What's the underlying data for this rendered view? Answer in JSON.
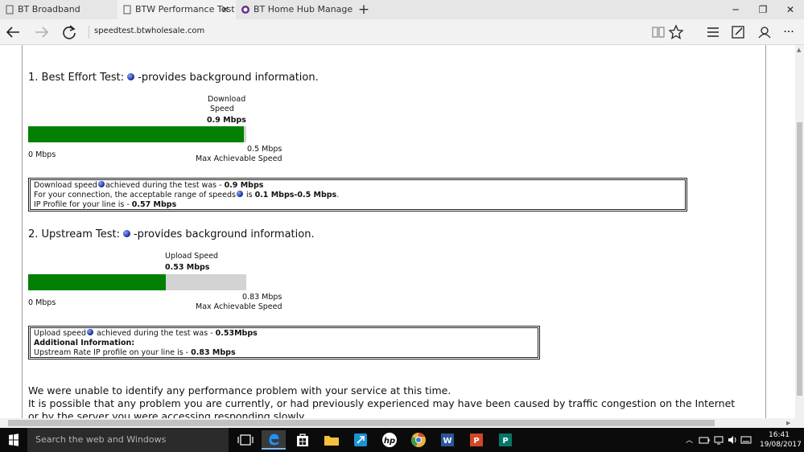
{
  "browser": {
    "tabs": [
      {
        "title": "BT Broadband",
        "active": false
      },
      {
        "title": "BTW Performance Test",
        "active": true
      },
      {
        "title": "BT Home Hub Manager - Ev",
        "active": false
      }
    ],
    "url_host": "speedtest.btwholesale.com"
  },
  "page": {
    "best_effort": {
      "title": "1. Best Effort Test:",
      "title_suffix": "-provides background information.",
      "speed_label_line1": "Download",
      "speed_label_line2": "Speed",
      "speed_value": "0.9 Mbps",
      "min_label": "0 Mbps",
      "max_value": "0.5 Mbps",
      "max_label": "Max Achievable Speed",
      "fill_fraction": 0.99,
      "info": {
        "line1_prefix": "Download speed",
        "line1_mid": "achieved during the test was - ",
        "line1_value": "0.9 Mbps",
        "line2_prefix": "For your connection, the acceptable range of speeds",
        "line2_mid": " is ",
        "line2_value": "0.1 Mbps-0.5 Mbps",
        "line2_suffix": ".",
        "line3_prefix": "IP Profile for your line is - ",
        "line3_value": "0.57 Mbps"
      }
    },
    "upstream": {
      "title": "2. Upstream Test:",
      "title_suffix": "-provides background information.",
      "speed_label": "Upload Speed",
      "speed_value": "0.53 Mbps",
      "min_label": "0 Mbps",
      "max_value": "0.83 Mbps",
      "max_label": "Max Achievable Speed",
      "fill_fraction": 0.63,
      "info": {
        "line1_prefix": "Upload speed",
        "line1_mid": " achieved during the test was - ",
        "line1_value": "0.53Mbps",
        "line2": "Additional Information:",
        "line3_prefix": "Upstream Rate IP profile on your line is - ",
        "line3_value": "0.83 Mbps"
      }
    },
    "message_line1": "We were unable to identify any performance problem with your service at this time.",
    "message_line2": "It is possible that any problem you are currently, or had previously experienced may have been caused by traffic congestion on the Internet",
    "message_line3": "or by the server you were accessing responding slowly."
  },
  "taskbar": {
    "search_placeholder": "Search the web and Windows",
    "time": "16:41",
    "date": "19/08/2017"
  },
  "colors": {
    "bar_fill": "#018001",
    "bar_track": "#d3d3d3"
  }
}
